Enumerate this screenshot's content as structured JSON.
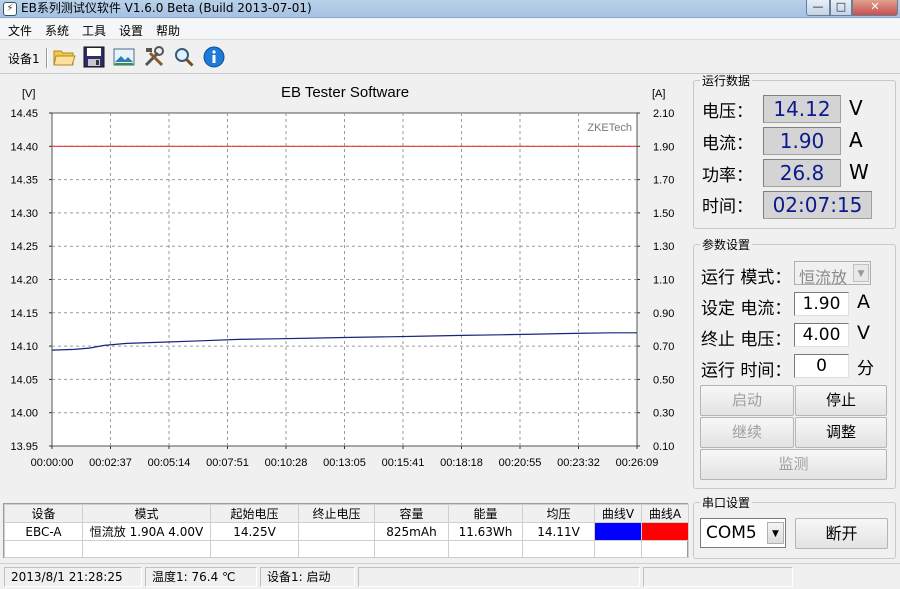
{
  "window": {
    "title": "EB系列测试仪软件 V1.6.0 Beta (Build 2013-07-01)",
    "min": "—",
    "max": "□",
    "close": "✕"
  },
  "menu": [
    "文件",
    "系统",
    "工具",
    "设置",
    "帮助"
  ],
  "toolbar": {
    "device": "设备1",
    "icons": [
      "folder-open-icon",
      "save-icon",
      "image-icon",
      "tools-icon",
      "zoom-icon",
      "info-icon"
    ]
  },
  "chart_data": {
    "type": "line",
    "title": "EB Tester Software",
    "watermark": "ZKETech",
    "left_unit": "[V]",
    "right_unit": "[A]",
    "ylim_left": [
      13.95,
      14.45
    ],
    "ylim_right": [
      0.1,
      2.1
    ],
    "yticks_left": [
      "14.45",
      "14.40",
      "14.35",
      "14.30",
      "14.25",
      "14.20",
      "14.15",
      "14.10",
      "14.05",
      "14.00",
      "13.95"
    ],
    "yticks_right": [
      "2.10",
      "1.90",
      "1.70",
      "1.50",
      "1.30",
      "1.10",
      "0.90",
      "0.70",
      "0.50",
      "0.30",
      "0.10"
    ],
    "xticks": [
      "00:00:00",
      "00:02:37",
      "00:05:14",
      "00:07:51",
      "00:10:28",
      "00:13:05",
      "00:15:41",
      "00:18:18",
      "00:20:55",
      "00:23:32",
      "00:26:09"
    ],
    "x_max_seconds": 1569,
    "grid": true,
    "series": [
      {
        "axis": "left",
        "color": "#1a237e",
        "x": [
          0,
          60,
          100,
          140,
          200,
          300,
          400,
          500,
          600,
          700,
          800,
          900,
          1000,
          1100,
          1200,
          1300,
          1400,
          1500,
          1569
        ],
        "y": [
          14.094,
          14.095,
          14.097,
          14.101,
          14.104,
          14.106,
          14.108,
          14.11,
          14.111,
          14.112,
          14.113,
          14.114,
          14.115,
          14.116,
          14.117,
          14.118,
          14.119,
          14.12,
          14.12
        ]
      },
      {
        "axis": "right",
        "color": "#e53935",
        "x": [
          0,
          1569
        ],
        "y": [
          1.9,
          1.9
        ]
      }
    ]
  },
  "run_data": {
    "legend": "运行数据",
    "voltage_label": "电压：",
    "voltage": "14.12",
    "voltage_unit": "V",
    "current_label": "电流：",
    "current": "1.90",
    "current_unit": "A",
    "power_label": "功率：",
    "power": "26.8",
    "power_unit": "W",
    "time_label": "时间：",
    "time": "02:07:15"
  },
  "params": {
    "legend": "参数设置",
    "mode_label": "运行 模式：",
    "mode": "恒流放",
    "current_label": "设定 电流：",
    "current": "1.90",
    "current_unit": "A",
    "cutoff_label": "终止 电压：",
    "cutoff": "4.00",
    "cutoff_unit": "V",
    "runtime_label": "运行 时间：",
    "runtime": "0",
    "runtime_unit": "分",
    "btn_start": "启动",
    "btn_stop": "停止",
    "btn_continue": "继续",
    "btn_adjust": "调整",
    "btn_monitor": "监测"
  },
  "serial": {
    "legend": "串口设置",
    "port": "COM5",
    "btn_disconnect": "断开"
  },
  "table": {
    "headers": [
      "设备",
      "模式",
      "起始电压",
      "终止电压",
      "容量",
      "能量",
      "均压",
      "曲线V",
      "曲线A"
    ],
    "row": {
      "device": "EBC-A",
      "mode": "恒流放  1.90A  4.00V",
      "start_v": "14.25V",
      "end_v": "",
      "capacity": "825mAh",
      "energy": "11.63Wh",
      "avg_v": "14.11V",
      "curve_v_color": "#0000ff",
      "curve_a_color": "#ff0000"
    }
  },
  "status": {
    "datetime": "2013/8/1 21:28:25",
    "temperature": "温度1: 76.4 ℃",
    "device_status": "设备1: 启动"
  }
}
